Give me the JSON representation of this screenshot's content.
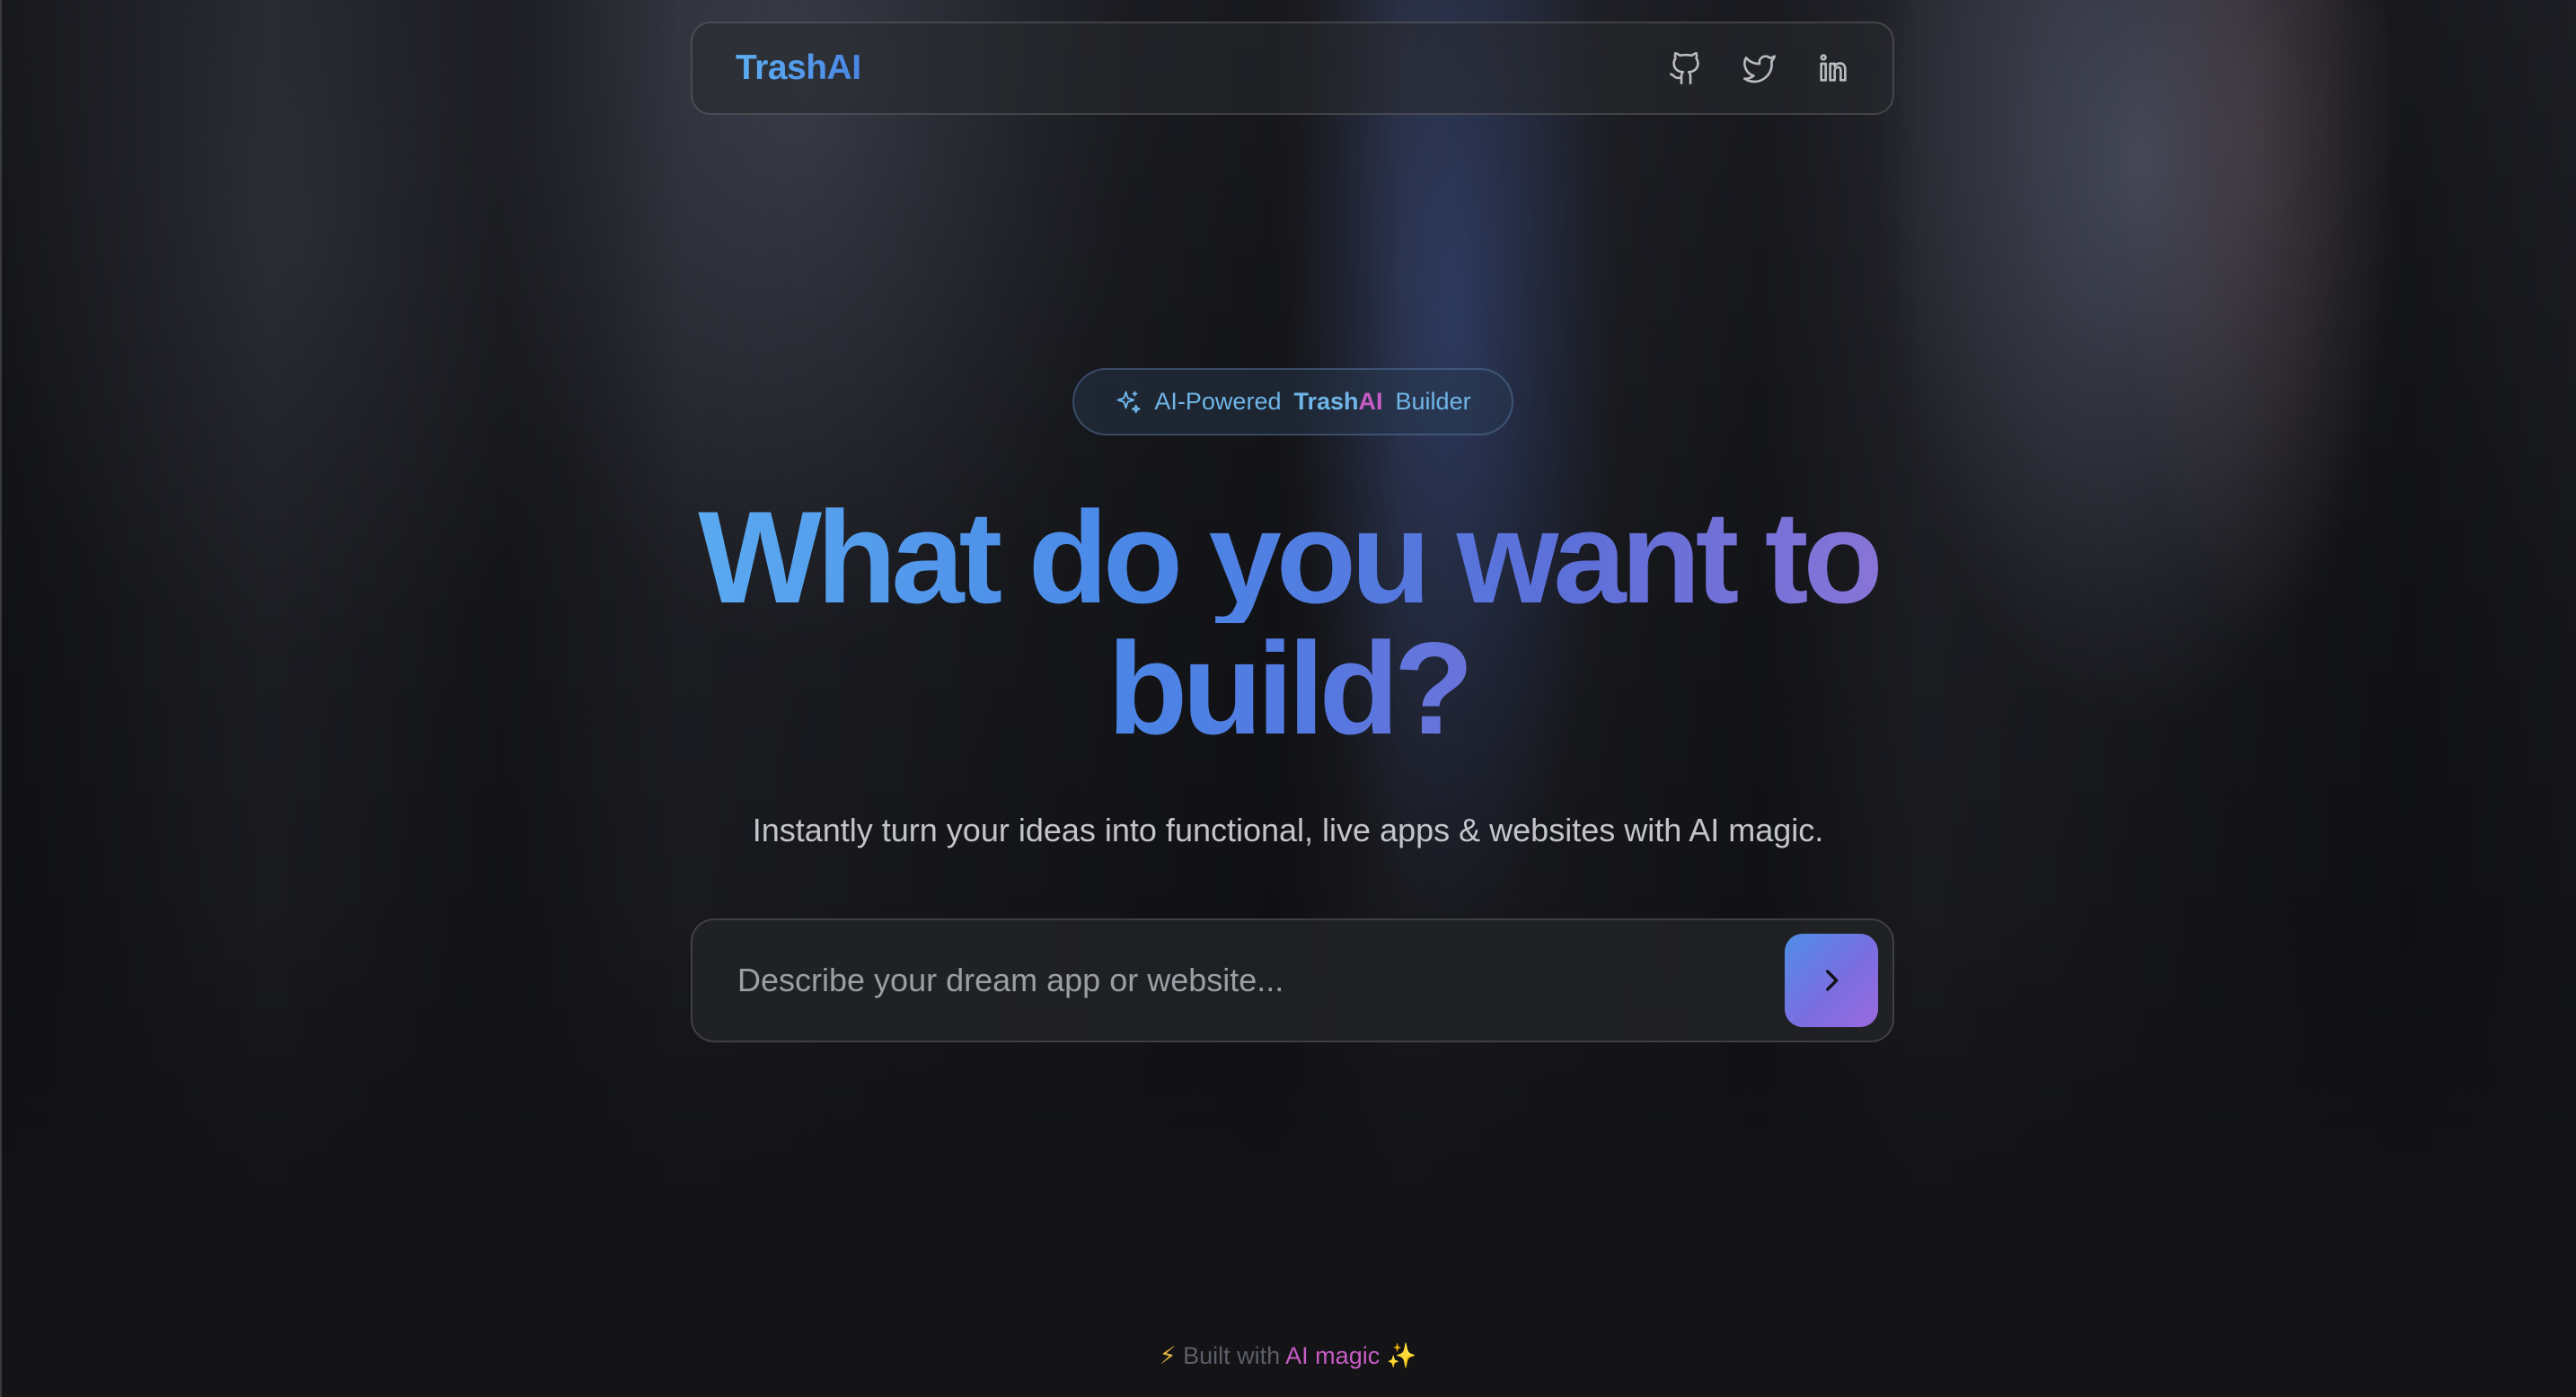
{
  "header": {
    "brand": "TrashAI",
    "socials": [
      {
        "name": "github",
        "icon": "github-icon"
      },
      {
        "name": "twitter",
        "icon": "twitter-icon"
      },
      {
        "name": "linkedin",
        "icon": "linkedin-icon"
      }
    ]
  },
  "badge": {
    "icon": "sparkles-icon",
    "prefix": "AI-Powered",
    "brand_main": "Trash",
    "brand_ai": "AI",
    "suffix": "Builder"
  },
  "hero": {
    "title_line1": "What do you want to",
    "title_line2": "build?",
    "subtitle": "Instantly turn your ideas into functional, live apps & websites with AI magic."
  },
  "prompt": {
    "placeholder": "Describe your dream app or website...",
    "value": "",
    "submit_icon": "chevron-right-icon"
  },
  "footer": {
    "bolt": "⚡",
    "prefix": "Built with",
    "highlight": "AI magic",
    "sparkle": "✨"
  },
  "colors": {
    "background": "#141416",
    "brand_blue": "#4a86e6",
    "light_blue": "#5fb4f3",
    "purple": "#9a76d6",
    "pink": "#c75cc4",
    "subtitle_text": "#c3c5cb"
  }
}
